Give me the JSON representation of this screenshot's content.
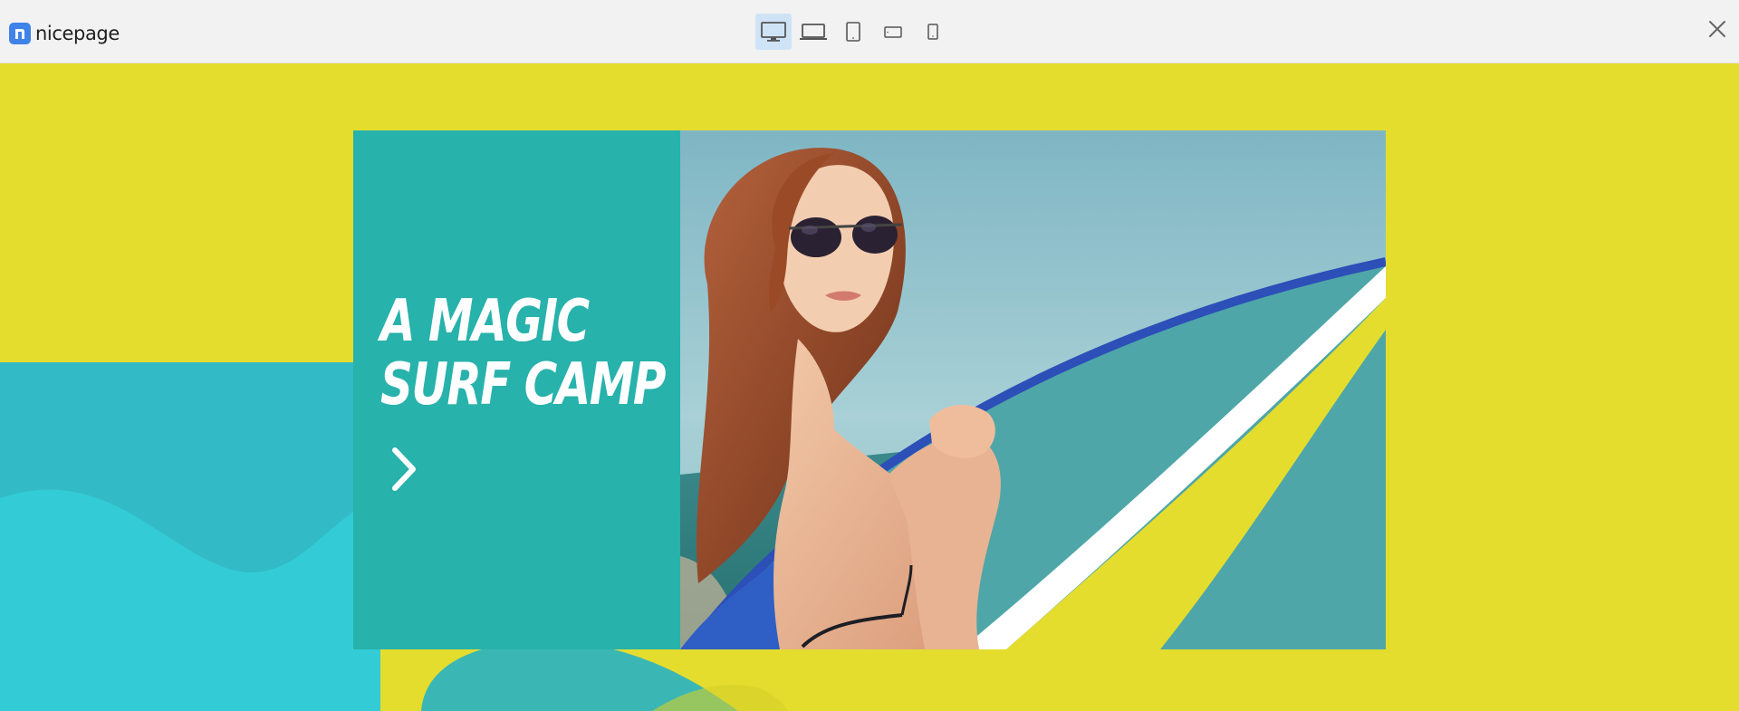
{
  "app": {
    "brand_name": "nicepage"
  },
  "toolbar": {
    "devices": [
      {
        "icon": "desktop-icon",
        "active": true
      },
      {
        "icon": "laptop-icon",
        "active": false
      },
      {
        "icon": "tablet-portrait-icon",
        "active": false
      },
      {
        "icon": "phone-landscape-icon",
        "active": false
      },
      {
        "icon": "phone-portrait-icon",
        "active": false
      }
    ],
    "close_icon": "close-icon"
  },
  "page": {
    "hero": {
      "title_line1": "A MAGIC",
      "title_line2": "SURF CAMP",
      "arrow_icon": "chevron-right-icon"
    },
    "colors": {
      "background_yellow": "#e4dd2e",
      "panel_teal": "#27b2ab",
      "wave_cyan": "#33ccd6",
      "brand_blue": "#3f83e8",
      "active_device_bg": "#cfe3f6"
    }
  }
}
